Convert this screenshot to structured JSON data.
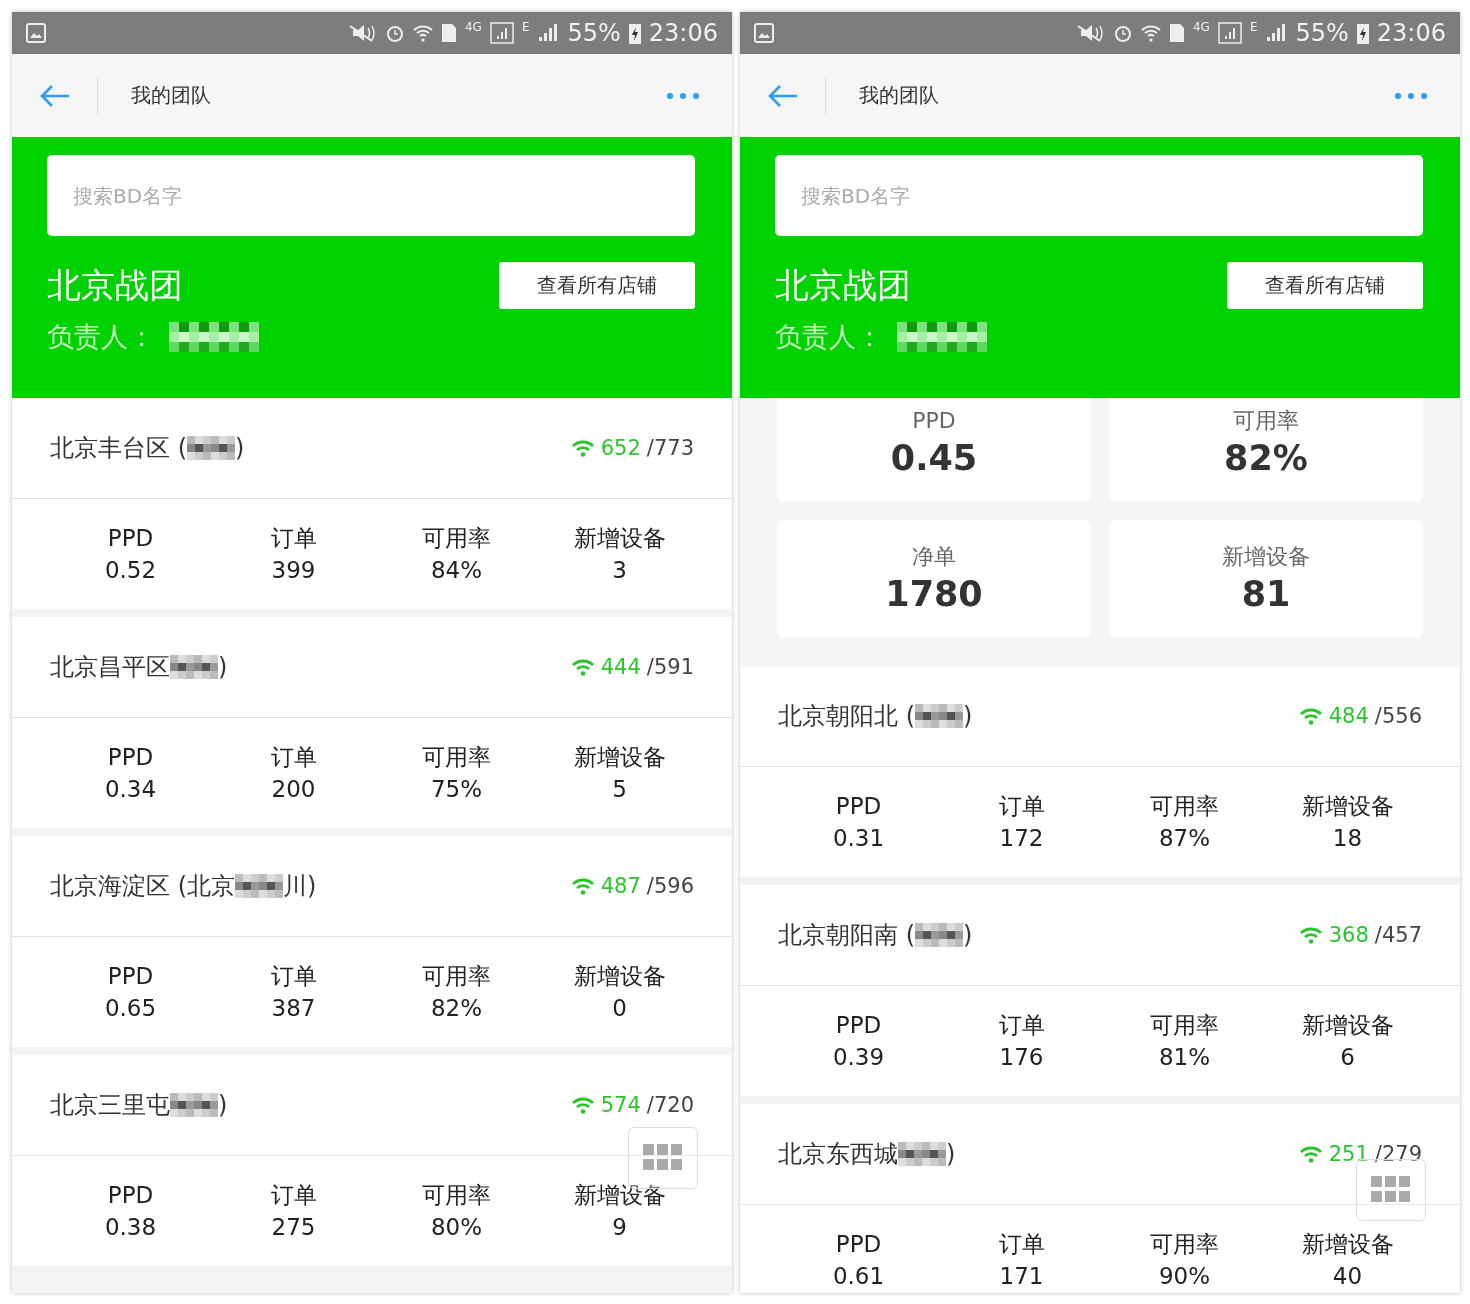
{
  "screens": [
    {
      "status_bar": {
        "network": "4G",
        "data": "E",
        "battery": "55%",
        "time": "23:06"
      },
      "title": "我的团队",
      "search": {
        "placeholder": "搜索BD名字"
      },
      "team": {
        "name": "北京战团",
        "button": "查看所有店铺",
        "manager_label": "负责人："
      },
      "groups": [
        {
          "name_before": "北京丰台区 (",
          "name_after": ")",
          "online": "652",
          "total": "/773",
          "stats": [
            {
              "label": "PPD",
              "value": "0.52"
            },
            {
              "label": "订单",
              "value": "399"
            },
            {
              "label": "可用率",
              "value": "84%"
            },
            {
              "label": "新增设备",
              "value": "3"
            }
          ]
        },
        {
          "name_before": "北京昌平区",
          "name_after": ")",
          "online": "444",
          "total": "/591",
          "stats": [
            {
              "label": "PPD",
              "value": "0.34"
            },
            {
              "label": "订单",
              "value": "200"
            },
            {
              "label": "可用率",
              "value": "75%"
            },
            {
              "label": "新增设备",
              "value": "5"
            }
          ]
        },
        {
          "name_before": "北京海淀区 (北京",
          "name_after": "川)",
          "online": "487",
          "total": "/596",
          "stats": [
            {
              "label": "PPD",
              "value": "0.65"
            },
            {
              "label": "订单",
              "value": "387"
            },
            {
              "label": "可用率",
              "value": "82%"
            },
            {
              "label": "新增设备",
              "value": "0"
            }
          ]
        },
        {
          "name_before": "北京三里屯",
          "name_after": ")",
          "online": "574",
          "total": "/720",
          "stats": [
            {
              "label": "PPD",
              "value": "0.38"
            },
            {
              "label": "订单",
              "value": "275"
            },
            {
              "label": "可用率",
              "value": "80%"
            },
            {
              "label": "新增设备",
              "value": "9"
            }
          ]
        }
      ]
    },
    {
      "status_bar": {
        "network": "4G",
        "data": "E",
        "battery": "55%",
        "time": "23:06"
      },
      "title": "我的团队",
      "search": {
        "placeholder": "搜索BD名字"
      },
      "team": {
        "name": "北京战团",
        "button": "查看所有店铺",
        "manager_label": "负责人："
      },
      "summary": [
        {
          "label": "PPD",
          "value": "0.45"
        },
        {
          "label": "可用率",
          "value": "82%"
        },
        {
          "label": "净单",
          "value": "1780"
        },
        {
          "label": "新增设备",
          "value": "81"
        }
      ],
      "groups": [
        {
          "name_before": "北京朝阳北 (",
          "name_after": ")",
          "online": "484",
          "total": "/556",
          "stats": [
            {
              "label": "PPD",
              "value": "0.31"
            },
            {
              "label": "订单",
              "value": "172"
            },
            {
              "label": "可用率",
              "value": "87%"
            },
            {
              "label": "新增设备",
              "value": "18"
            }
          ]
        },
        {
          "name_before": "北京朝阳南 (",
          "name_after": ")",
          "online": "368",
          "total": "/457",
          "stats": [
            {
              "label": "PPD",
              "value": "0.39"
            },
            {
              "label": "订单",
              "value": "176"
            },
            {
              "label": "可用率",
              "value": "81%"
            },
            {
              "label": "新增设备",
              "value": "6"
            }
          ]
        },
        {
          "name_before": "北京东西城",
          "name_after": ")",
          "online": "251",
          "total": "/279",
          "stats": [
            {
              "label": "PPD",
              "value": "0.61"
            },
            {
              "label": "订单",
              "value": "171"
            },
            {
              "label": "可用率",
              "value": "90%"
            },
            {
              "label": "新增设备",
              "value": "40"
            }
          ]
        }
      ]
    }
  ]
}
